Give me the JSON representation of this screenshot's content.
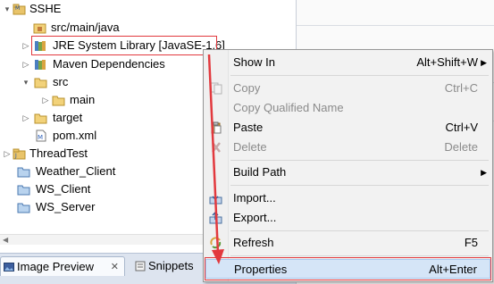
{
  "explorer": {
    "items": [
      {
        "label": "SSHE",
        "twisty": "▾",
        "icon": "java-project-icon"
      },
      {
        "label": "src/main/java",
        "twisty": "",
        "icon": "source-folder-icon"
      },
      {
        "label": "JRE System Library [JavaSE-1.6]",
        "twisty": "▷",
        "icon": "library-icon"
      },
      {
        "label": "Maven Dependencies",
        "twisty": "▷",
        "icon": "library-icon"
      },
      {
        "label": "src",
        "twisty": "▾",
        "icon": "folder-icon"
      },
      {
        "label": "main",
        "twisty": "▷",
        "icon": "folder-icon"
      },
      {
        "label": "target",
        "twisty": "▷",
        "icon": "folder-icon"
      },
      {
        "label": "pom.xml",
        "twisty": "",
        "icon": "xml-file-icon"
      },
      {
        "label": "ThreadTest",
        "twisty": "▷",
        "icon": "java-project-icon"
      },
      {
        "label": "Weather_Client",
        "twisty": "",
        "icon": "closed-project-icon"
      },
      {
        "label": "WS_Client",
        "twisty": "",
        "icon": "closed-project-icon"
      },
      {
        "label": "WS_Server",
        "twisty": "",
        "icon": "closed-project-icon"
      }
    ]
  },
  "view_tabs": {
    "image_preview": "Image Preview",
    "image_preview_close": "✕",
    "snippets": "Snippets"
  },
  "context_menu": {
    "show_in": "Show In",
    "show_in_key": "Alt+Shift+W",
    "copy": "Copy",
    "copy_key": "Ctrl+C",
    "copy_qualified_name": "Copy Qualified Name",
    "paste": "Paste",
    "paste_key": "Ctrl+V",
    "delete": "Delete",
    "delete_key": "Delete",
    "build_path": "Build Path",
    "import": "Import...",
    "export": "Export...",
    "refresh": "Refresh",
    "refresh_key": "F5",
    "properties": "Properties",
    "properties_key": "Alt+Enter",
    "submenu_arrow": "▶"
  },
  "colors": {
    "annotation_red": "#e2393e",
    "menu_highlight": "#d5e5f7"
  }
}
